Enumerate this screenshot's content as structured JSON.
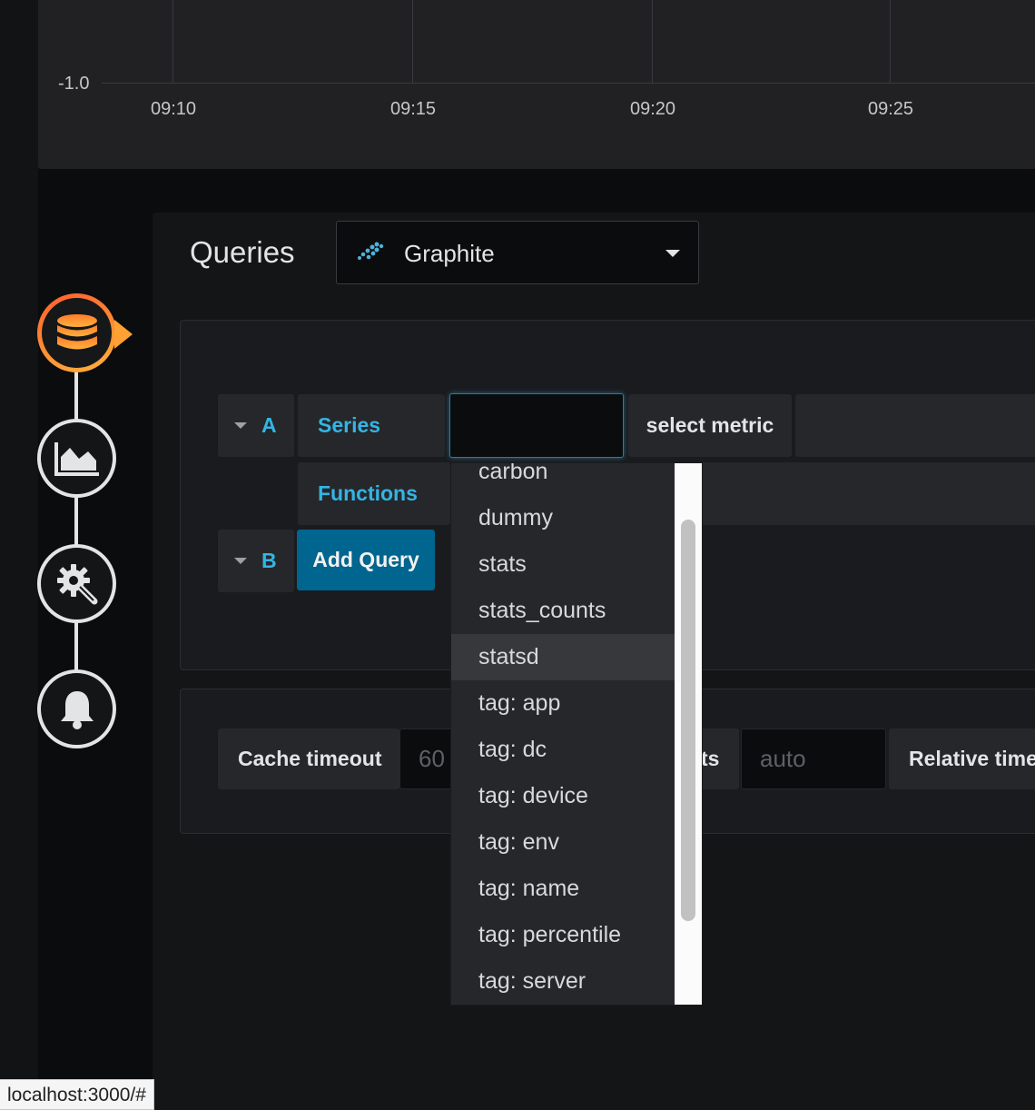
{
  "graph": {
    "y_tick": "-1.0",
    "x_ticks": [
      "09:10",
      "09:15",
      "09:20",
      "09:25"
    ]
  },
  "editor": {
    "title": "Queries",
    "datasource": {
      "name": "Graphite",
      "icon": "graphite-icon"
    }
  },
  "steps": [
    {
      "name": "queries",
      "icon": "database-icon",
      "active": true
    },
    {
      "name": "visualization",
      "icon": "area-chart-icon",
      "active": false
    },
    {
      "name": "general",
      "icon": "cog-wrench-icon",
      "active": false
    },
    {
      "name": "alert",
      "icon": "bell-icon",
      "active": false
    }
  ],
  "query_a": {
    "ref_id": "A",
    "series_label": "Series",
    "metric_input_value": "",
    "select_metric": "select metric",
    "functions_label": "Functions"
  },
  "query_b": {
    "ref_id": "B",
    "add_query_label": "Add Query"
  },
  "options": {
    "cache_timeout_label": "Cache timeout",
    "cache_timeout_placeholder": "60",
    "max_points_label_partial": "ts",
    "max_points_placeholder": "auto",
    "relative_time_label": "Relative time"
  },
  "metric_dropdown": {
    "items": [
      "carbon",
      "dummy",
      "stats",
      "stats_counts",
      "statsd",
      "tag: app",
      "tag: dc",
      "tag: device",
      "tag: env",
      "tag: name",
      "tag: percentile",
      "tag: server"
    ],
    "highlighted": "statsd"
  },
  "status_bar": {
    "url": "localhost:3000/#"
  },
  "colors": {
    "accent_blue": "#33b5e5",
    "primary_button": "#00658f",
    "active_step_gradient": [
      "#ff5f2e",
      "#ffb23a"
    ]
  }
}
